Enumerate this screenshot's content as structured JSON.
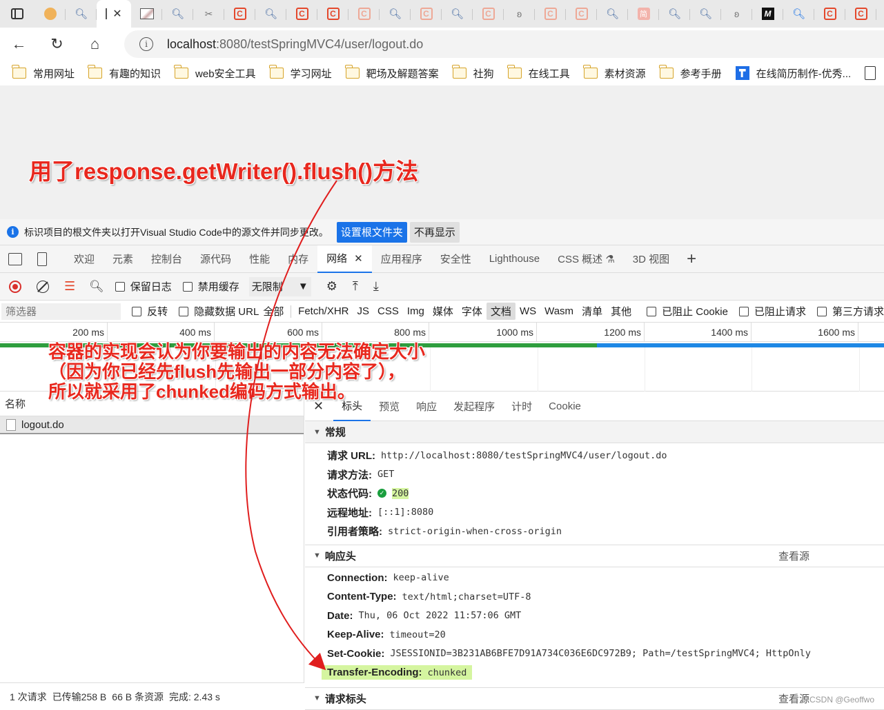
{
  "browser": {
    "active_tab_label": "I",
    "url_host": "localhost",
    "url_path": ":8080/testSpringMVC4/user/logout.do"
  },
  "bookmarks": [
    {
      "label": "常用网址"
    },
    {
      "label": "有趣的知识"
    },
    {
      "label": "web安全工具"
    },
    {
      "label": "学习网址"
    },
    {
      "label": "靶场及解题答案"
    },
    {
      "label": "社狗"
    },
    {
      "label": "在线工具"
    },
    {
      "label": "素材资源"
    },
    {
      "label": "参考手册"
    },
    {
      "label": "在线简历制作-优秀..."
    }
  ],
  "infobar": {
    "text": "标识项目的根文件夹以打开Visual Studio Code中的源文件并同步更改。",
    "primary_button": "设置根文件夹",
    "secondary_button": "不再显示"
  },
  "devtools_tabs": [
    "欢迎",
    "元素",
    "控制台",
    "源代码",
    "性能",
    "内存",
    "网络",
    "应用程序",
    "安全性",
    "Lighthouse",
    "CSS 概述",
    "3D 视图"
  ],
  "network_toolbar": {
    "preserve_log": "保留日志",
    "disable_cache": "禁用缓存",
    "throttle": "无限制"
  },
  "filter_row": {
    "placeholder": "筛选器",
    "invert": "反转",
    "hide_data_urls": "隐藏数据 URL",
    "types": [
      "全部",
      "Fetch/XHR",
      "JS",
      "CSS",
      "Img",
      "媒体",
      "字体",
      "文档",
      "WS",
      "Wasm",
      "清单",
      "其他"
    ],
    "blocked_cookies": "已阻止 Cookie",
    "blocked_requests": "已阻止请求",
    "third_party": "第三方请求"
  },
  "timeline": {
    "ticks": [
      "200 ms",
      "400 ms",
      "600 ms",
      "800 ms",
      "1000 ms",
      "1200 ms",
      "1400 ms",
      "1600 ms"
    ]
  },
  "request_list": {
    "header": "名称",
    "rows": [
      {
        "name": "logout.do"
      }
    ]
  },
  "statusbar": {
    "requests": "1 次请求",
    "transferred": "已传输258 B",
    "resources": "66 B 条资源",
    "finish": "完成: 2.43 s"
  },
  "detail_tabs": [
    "标头",
    "预览",
    "响应",
    "发起程序",
    "计时",
    "Cookie"
  ],
  "general": {
    "title": "常规",
    "rows": [
      {
        "key": "请求 URL:",
        "value": "http://localhost:8080/testSpringMVC4/user/logout.do"
      },
      {
        "key": "请求方法:",
        "value": "GET"
      },
      {
        "key": "状态代码:",
        "value": "200"
      },
      {
        "key": "远程地址:",
        "value": "[::1]:8080"
      },
      {
        "key": "引用者策略:",
        "value": "strict-origin-when-cross-origin"
      }
    ]
  },
  "response_headers": {
    "title": "响应头",
    "view_source": "查看源",
    "rows": [
      {
        "key": "Connection:",
        "value": "keep-alive"
      },
      {
        "key": "Content-Type:",
        "value": "text/html;charset=UTF-8"
      },
      {
        "key": "Date:",
        "value": "Thu, 06 Oct 2022 11:57:06 GMT"
      },
      {
        "key": "Keep-Alive:",
        "value": "timeout=20"
      },
      {
        "key": "Set-Cookie:",
        "value": "JSESSIONID=3B231AB6BFE7D91A734C036E6DC972B9; Path=/testSpringMVC4; HttpOnly"
      },
      {
        "key": "Transfer-Encoding:",
        "value": "chunked"
      }
    ]
  },
  "request_headers": {
    "title": "请求标头",
    "view_source": "查看源"
  },
  "annotations": {
    "top": "用了response.getWriter().flush()方法",
    "middle_line1": "容器的实现会认为你要输出的内容无法确定大小",
    "middle_line2": "（因为你已经先flush先输出一部分内容了），",
    "middle_line3": "所以就采用了chunked编码方式输出。"
  },
  "watermark": "CSDN @Geoffwo",
  "colors": {
    "accent": "#1a73e8",
    "annotation_red": "#e8281e",
    "highlight_green": "#d5f5a0"
  }
}
